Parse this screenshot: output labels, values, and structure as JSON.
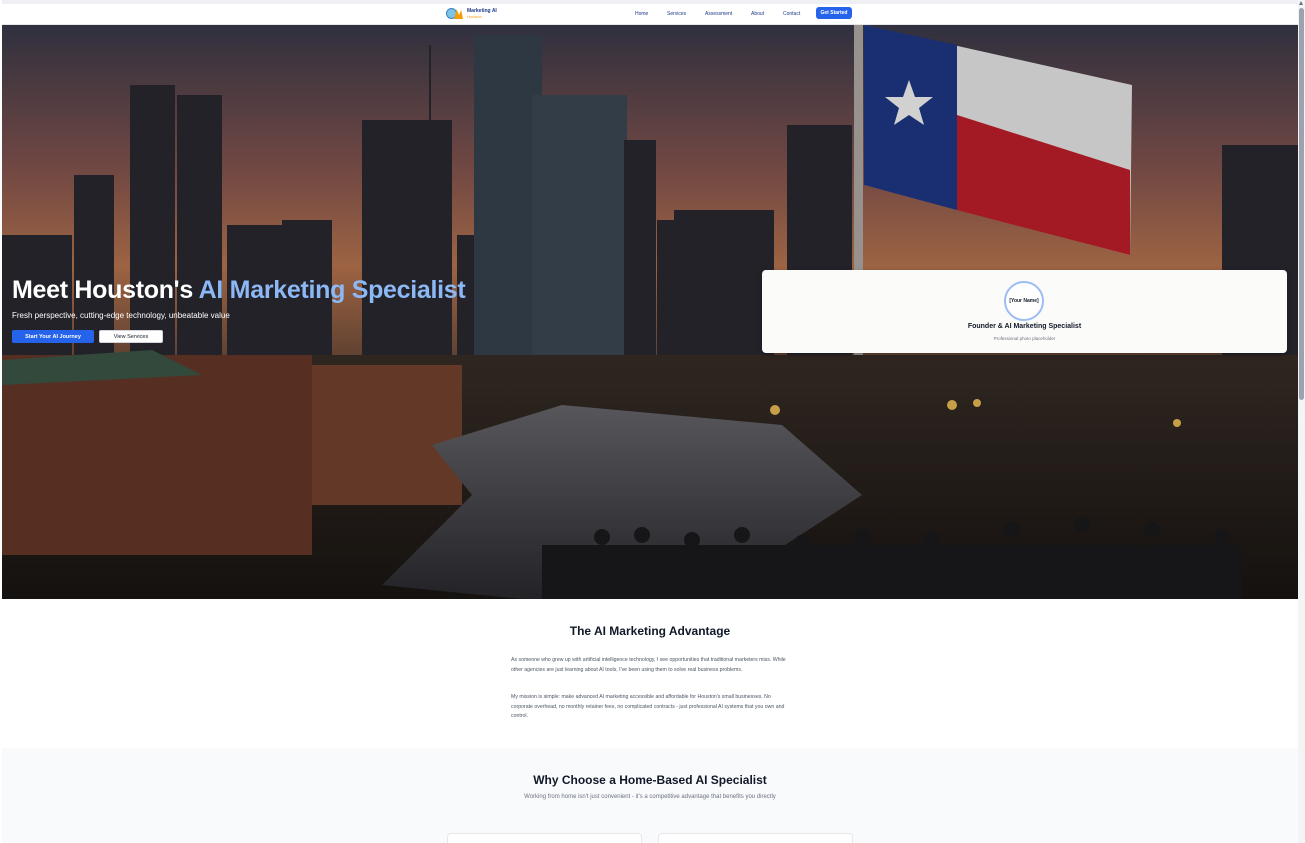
{
  "brand": {
    "name_line1": "Marketing AI",
    "name_line2": "Houston"
  },
  "nav": {
    "items": [
      "Home",
      "Services",
      "Assessment",
      "About",
      "Contact"
    ],
    "cta": "Get Started"
  },
  "hero": {
    "title_main": "Meet Houston's ",
    "title_accent": "AI Marketing Specialist",
    "subtitle": "Fresh perspective, cutting-edge technology, unbeatable value",
    "primary_button": "Start Your AI Journey",
    "secondary_button": "View Services"
  },
  "profile": {
    "name": "[Your Name]",
    "title": "Founder & AI Marketing Specialist",
    "note": "Professional photo placeholder"
  },
  "advantage": {
    "title": "The AI Marketing Advantage",
    "p1": "As someone who grew up with artificial intelligence technology, I see opportunities that traditional marketers miss. While other agencies are just learning about AI tools, I've been using them to solve real business problems.",
    "p2": "My mission is simple: make advanced AI marketing accessible and affordable for Houston's small businesses. No corporate overhead, no monthly retainer fees, no complicated contracts - just professional AI systems that you own and control."
  },
  "why": {
    "title": "Why Choose a Home-Based AI Specialist",
    "subtitle": "Working from home isn't just convenient - it's a competitive advantage that benefits you directly"
  },
  "colors": {
    "primary": "#2563eb",
    "accent_text": "#8cb8f5",
    "nav_text": "#1e3a8a",
    "brand_orange": "#f59e0b"
  }
}
